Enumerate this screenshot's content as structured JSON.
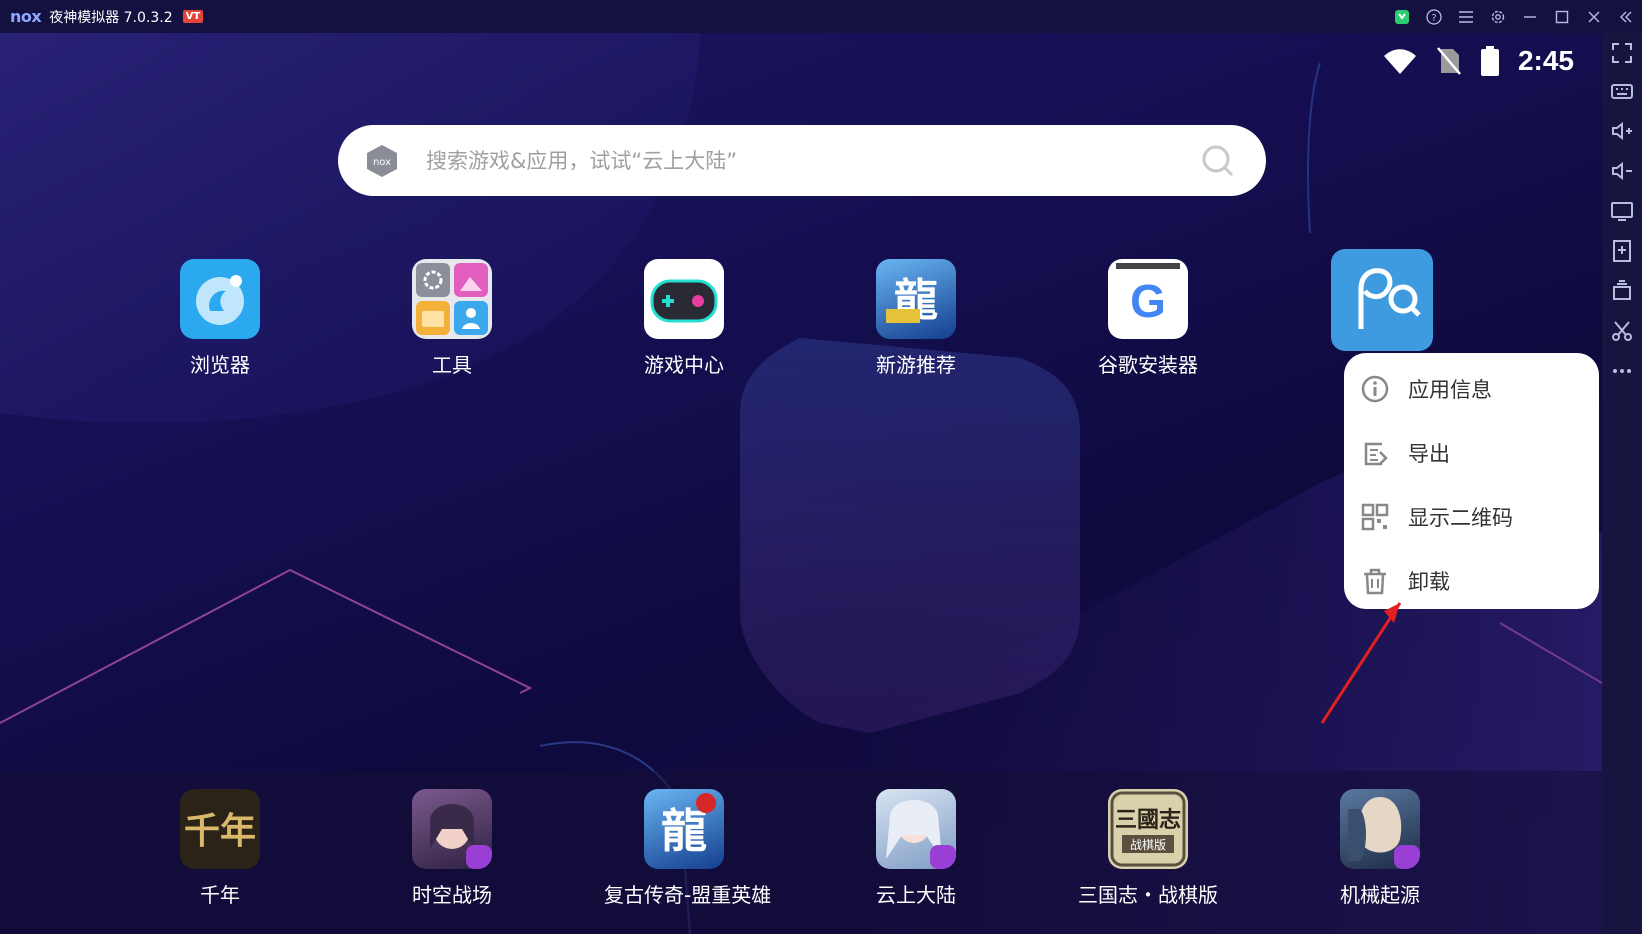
{
  "titlebar": {
    "logo": "nox",
    "title": "夜神模拟器 7.0.3.2",
    "vt_badge": "VT",
    "controls": [
      "bookmark-icon",
      "help-icon",
      "menu-icon",
      "settings-icon",
      "minimize-icon",
      "maximize-icon",
      "close-icon",
      "collapse-sidebar-icon"
    ]
  },
  "status": {
    "time": "2:45",
    "icons": [
      "wifi-icon",
      "no-sim-icon",
      "battery-icon"
    ]
  },
  "search": {
    "placeholder": "搜索游戏&应用，试试“云上大陆”"
  },
  "apps": [
    {
      "label": "浏览器",
      "icon": "browser-icon",
      "color": "#2aa9ef"
    },
    {
      "label": "工具",
      "icon": "tools-icon",
      "color": "#d7dbe3"
    },
    {
      "label": "游戏中心",
      "icon": "game-center-icon",
      "color": "#ffffff"
    },
    {
      "label": "新游推荐",
      "icon": "new-games-icon",
      "color": "#1a4fa0"
    },
    {
      "label": "谷歌安装器",
      "icon": "google-installer-icon",
      "color": "#ffffff"
    }
  ],
  "selected_app": {
    "icon": "picked-app-icon",
    "color": "#3e9bdf"
  },
  "context_menu": {
    "items": [
      {
        "label": "应用信息",
        "icon": "info-icon"
      },
      {
        "label": "导出",
        "icon": "export-icon"
      },
      {
        "label": "显示二维码",
        "icon": "qr-code-icon"
      },
      {
        "label": "卸载",
        "icon": "trash-icon"
      }
    ]
  },
  "dock": [
    {
      "label": "千年",
      "icon": "qiannian-icon",
      "color": "#2b2218"
    },
    {
      "label": "时空战场",
      "icon": "shikong-icon",
      "color": "#5a3a6e"
    },
    {
      "label": "复古传奇-盟重英雄",
      "icon": "fugu-chuanqi-icon",
      "color": "#1a4fa0"
    },
    {
      "label": "云上大陆",
      "icon": "yunshang-icon",
      "color": "#9fb8d8"
    },
    {
      "label": "三国志・战棋版",
      "icon": "sanguozhi-icon",
      "color": "#cfc6a0"
    },
    {
      "label": "机械起源",
      "icon": "jixie-icon",
      "color": "#3a4f6e"
    }
  ],
  "sidebar": [
    "fullscreen-icon",
    "keyboard-icon",
    "volume-up-icon",
    "volume-down-icon",
    "screen-icon",
    "add-apk-icon",
    "multi-instance-icon",
    "scissors-icon",
    "more-icon"
  ]
}
